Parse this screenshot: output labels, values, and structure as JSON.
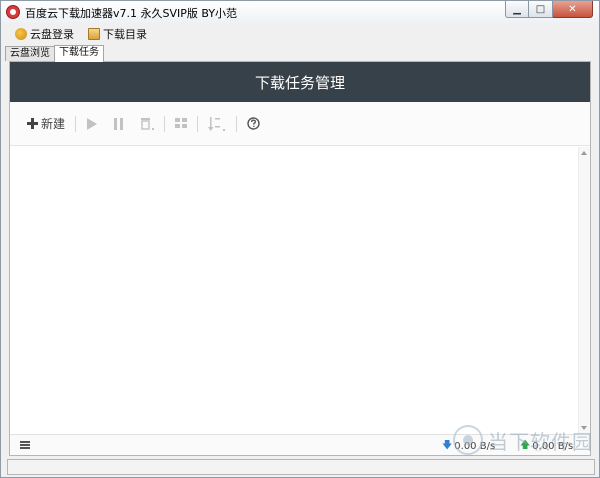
{
  "window": {
    "title": "百度云下载加速器v7.1 永久SVIP版 BY小范",
    "min_glyph": "▁",
    "max_glyph": "□",
    "close_glyph": "✕"
  },
  "menu": {
    "items": [
      {
        "label": "云盘登录",
        "icon": "cloud-login-icon"
      },
      {
        "label": "下载目录",
        "icon": "folder-icon"
      }
    ]
  },
  "tabs": [
    {
      "label": "云盘浏览",
      "active": false
    },
    {
      "label": "下载任务",
      "active": true
    }
  ],
  "header": {
    "title": "下载任务管理"
  },
  "toolbar": {
    "new_label": "新建",
    "buttons": [
      "plus-icon",
      "play-icon",
      "pause-icon",
      "trash-icon",
      "grid-icon",
      "sort-az-icon",
      "help-icon"
    ]
  },
  "footer": {
    "download_speed": "0.00 B/s",
    "upload_speed": "0.00 B/s"
  },
  "watermark": {
    "text": "当下软件园"
  },
  "colors": {
    "header_bg": "#374149",
    "download_arrow": "#2f7fd3",
    "upload_arrow": "#2fa84a"
  }
}
